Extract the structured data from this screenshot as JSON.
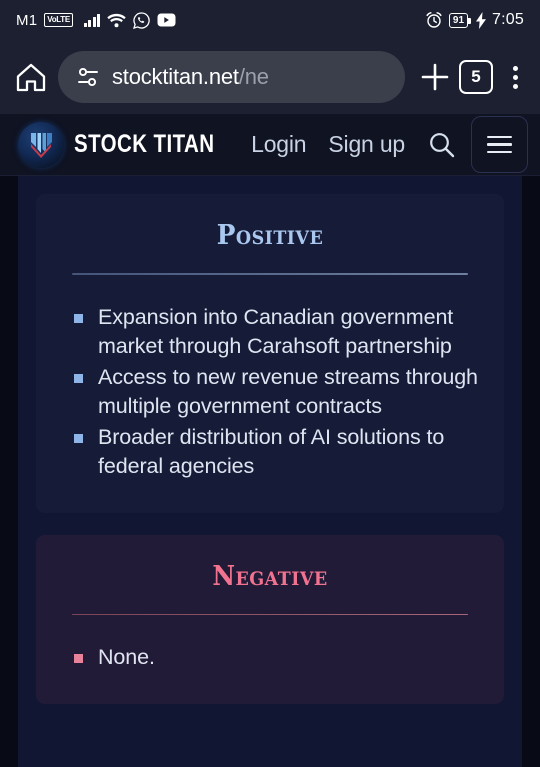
{
  "statusbar": {
    "carrier": "M1",
    "volte_badge": "VoLTE",
    "battery_percent": "91",
    "time": "7:05",
    "icons": [
      "signal-bars-icon",
      "wifi-icon",
      "whatsapp-icon",
      "youtube-icon",
      "alarm-clock-icon",
      "battery-icon",
      "charging-bolt-icon"
    ]
  },
  "browser": {
    "home_icon": "home-icon",
    "url_icon": "page-settings-icon",
    "url_domain": "stocktitan.net",
    "url_path": "/ne",
    "new_tab_label": "+",
    "tab_count": "5",
    "menu_icon": "three-dot-menu-icon"
  },
  "site_header": {
    "logo_icon": "stock-titan-logo-icon",
    "brand": "STOCK TITAN",
    "login_label": "Login",
    "signup_label": "Sign up",
    "search_icon": "search-icon",
    "hamburger_icon": "hamburger-menu-icon"
  },
  "main": {
    "cards": [
      {
        "id": "positive",
        "title": "Positive",
        "accent": "#a9c7ef",
        "bullet_color": "#8fb4e8",
        "points": [
          "Expansion into Canadian government market through Carahsoft partnership",
          "Access to new revenue streams through multiple government contracts",
          "Broader distribution of AI solutions to federal agencies"
        ]
      },
      {
        "id": "negative",
        "title": "Negative",
        "accent": "#f2738f",
        "bullet_color": "#e8829b",
        "points": [
          "None."
        ]
      }
    ]
  }
}
